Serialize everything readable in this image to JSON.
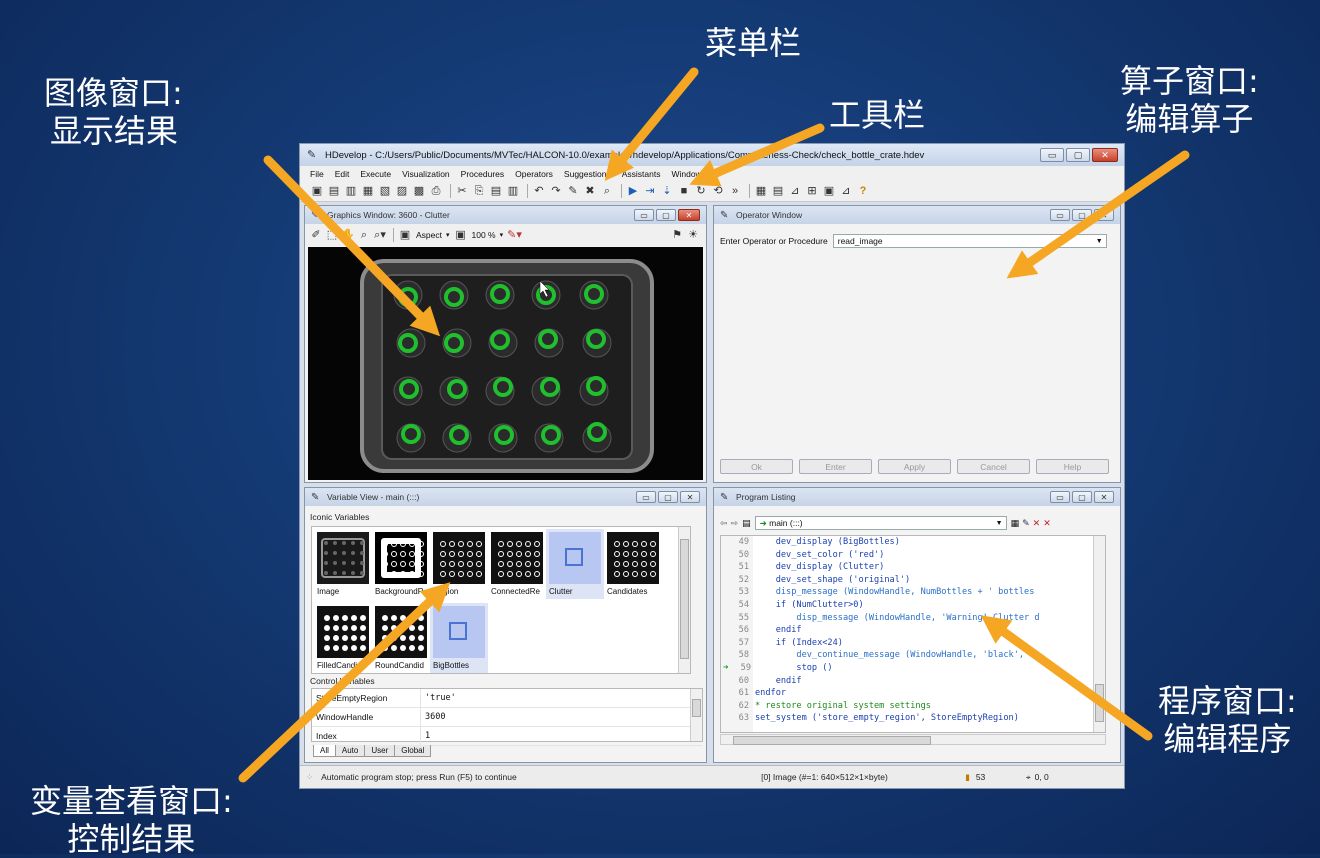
{
  "annotations": {
    "image_window": {
      "line1": "图像窗口:",
      "line2": "显示结果"
    },
    "menu_bar": "菜单栏",
    "tool_bar": "工具栏",
    "operator_window": {
      "line1": "算子窗口:",
      "line2": "编辑算子"
    },
    "program_window": {
      "line1": "程序窗口:",
      "line2": "编辑程序"
    },
    "variable_window": {
      "line1": "变量查看窗口:",
      "line2": "控制结果"
    }
  },
  "colors": {
    "arrow": "#f5a623",
    "ring": "#1fbf2e"
  },
  "app": {
    "title": "HDevelop - C:/Users/Public/Documents/MVTec/HALCON-10.0/examples/hdevelop/Applications/Completeness-Check/check_bottle_crate.hdev",
    "window_buttons": {
      "min": "▭",
      "max": "▢",
      "close": "✕"
    },
    "menu": [
      "File",
      "Edit",
      "Execute",
      "Visualization",
      "Procedures",
      "Operators",
      "Suggestions",
      "Assistants",
      "Window"
    ],
    "toolbar_icons": [
      "new-icon",
      "open-icon",
      "open-example-icon",
      "save-icon",
      "save-as-icon",
      "export-icon",
      "insert-icon",
      "print-icon",
      "cut-icon",
      "copy-icon",
      "paste-icon",
      "paste-special-icon",
      "undo-icon",
      "redo-icon",
      "edit-icon",
      "delete-icon",
      "find-icon",
      "run-icon",
      "step-over-icon",
      "step-into-icon",
      "stop-icon",
      "reset-icon",
      "reset-program-icon",
      "more-icon",
      "graphics-window-icon",
      "variable-window-icon",
      "line-profile-icon",
      "histogram-icon",
      "zoom-window-icon",
      "feature-inspection-icon",
      "help-icon"
    ]
  },
  "graphics": {
    "title": "Graphics Window: 3600 - Clutter",
    "aspect_label": "Aspect",
    "zoom_label": "100 %"
  },
  "operator": {
    "title": "Operator Window",
    "prompt": "Enter Operator or Procedure",
    "value": "read_image",
    "buttons": [
      "Ok",
      "Enter",
      "Apply",
      "Cancel",
      "Help"
    ]
  },
  "variables": {
    "title": "Variable View - main (:::)",
    "iconic_label": "Iconic Variables",
    "iconic": [
      {
        "name": "Image",
        "kind": "photo"
      },
      {
        "name": "BackgroundR",
        "kind": "bw"
      },
      {
        "name": "Region",
        "kind": "dots"
      },
      {
        "name": "ConnectedRe",
        "kind": "dots"
      },
      {
        "name": "Clutter",
        "kind": "empty",
        "selected": true
      },
      {
        "name": "Candidates",
        "kind": "dots"
      },
      {
        "name": "FilledCandid",
        "kind": "fill"
      },
      {
        "name": "RoundCandid",
        "kind": "fill"
      },
      {
        "name": "BigBottles",
        "kind": "empty",
        "selected": true
      }
    ],
    "control_label": "Control Variables",
    "control": [
      {
        "name": "StoreEmptyRegion",
        "value": "'true'"
      },
      {
        "name": "WindowHandle",
        "value": "3600"
      },
      {
        "name": "Index",
        "value": "1"
      }
    ],
    "tabs": [
      "All",
      "Auto",
      "User",
      "Global"
    ]
  },
  "program": {
    "title": "Program Listing",
    "procedure": "main (:::)",
    "lines": [
      {
        "n": "49",
        "code": "    dev_display (BigBottles)",
        "color": "#1a3fb0"
      },
      {
        "n": "50",
        "code": "    dev_set_color ('red')",
        "color": "#1a3fb0"
      },
      {
        "n": "51",
        "code": "    dev_display (Clutter)",
        "color": "#1a3fb0"
      },
      {
        "n": "52",
        "code": "    dev_set_shape ('original')",
        "color": "#1a3fb0"
      },
      {
        "n": "53",
        "code": "    disp_message (WindowHandle, NumBottles + ' bottles",
        "color": "#2a6fc8"
      },
      {
        "n": "54",
        "code": "    if (NumClutter>0)",
        "color": "#1a3fb0"
      },
      {
        "n": "55",
        "code": "        disp_message (WindowHandle, 'Warning! Clutter d",
        "color": "#2a6fc8"
      },
      {
        "n": "56",
        "code": "    endif",
        "color": "#1a3fb0"
      },
      {
        "n": "57",
        "code": "    if (Index<24)",
        "color": "#1a3fb0"
      },
      {
        "n": "58",
        "code": "        dev_continue_message (WindowHandle, 'black', '",
        "color": "#2a6fc8"
      },
      {
        "n": "59",
        "code": "        stop ()",
        "color": "#1a3fb0",
        "pc": true
      },
      {
        "n": "60",
        "code": "    endif",
        "color": "#1a3fb0"
      },
      {
        "n": "61",
        "code": "endfor",
        "color": "#1a3fb0"
      },
      {
        "n": "62",
        "code": "* restore original system settings",
        "color": "#1e8a1e"
      },
      {
        "n": "63",
        "code": "set_system ('store_empty_region', StoreEmptyRegion)",
        "color": "#1a3fb0"
      }
    ]
  },
  "status": {
    "message": "Automatic program stop; press Run (F5) to continue",
    "image_info": "[0] Image (#=1: 640×512×1×byte)",
    "memory": "53",
    "coords": "0, 0"
  }
}
